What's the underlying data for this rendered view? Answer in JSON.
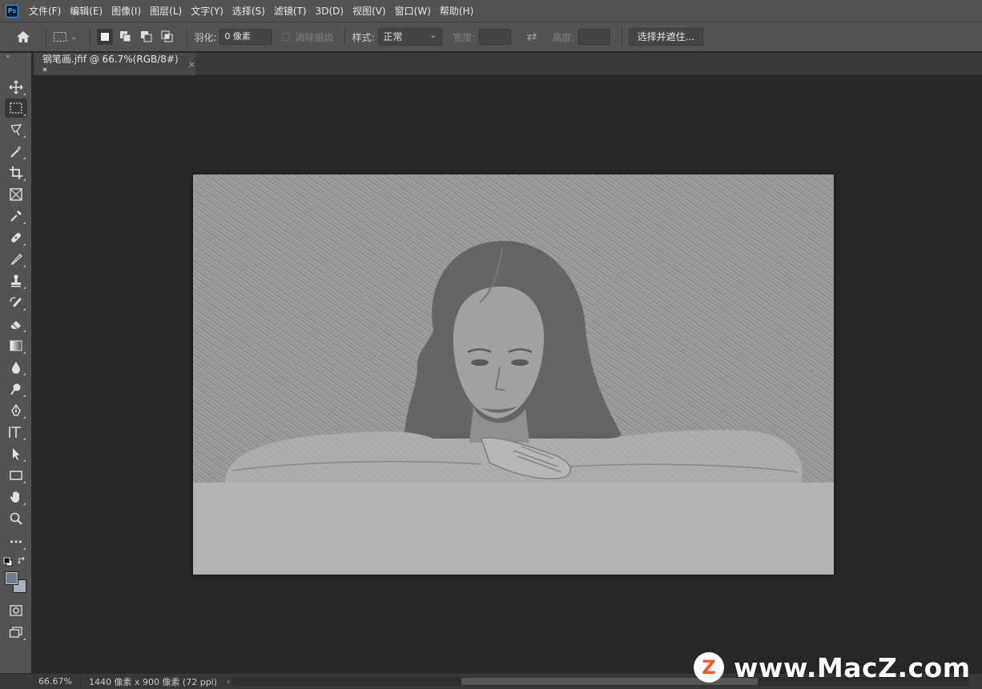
{
  "app": {
    "logo_text": "Ps"
  },
  "menu": [
    "文件(F)",
    "编辑(E)",
    "图像(I)",
    "图层(L)",
    "文字(Y)",
    "选择(S)",
    "滤镜(T)",
    "3D(D)",
    "视图(V)",
    "窗口(W)",
    "帮助(H)"
  ],
  "options": {
    "feather_label": "羽化:",
    "feather_value": "0 像素",
    "antialias_label": "消除锯齿",
    "style_label": "样式:",
    "style_value": "正常",
    "width_label": "宽度:",
    "height_label": "高度:",
    "select_mask_button": "选择并遮住..."
  },
  "tab": {
    "title": "钢笔画.jfif @ 66.7%(RGB/8#) *",
    "close": "×"
  },
  "status": {
    "zoom": "66.67%",
    "doc_info": "1440 像素 x 900 像素 (72 ppi)",
    "arrow": "›"
  },
  "watermark": {
    "logo": "Z",
    "text": "www.MacZ.com"
  },
  "colors": {
    "foreground": "#6f7c8d",
    "background": "#a7b0be",
    "accent": "#31a8ff"
  },
  "tools": [
    "move-icon",
    "marquee-icon",
    "lasso-icon",
    "magic-wand-icon",
    "crop-icon",
    "frame-icon",
    "eyedropper-icon",
    "healing-brush-icon",
    "brush-icon",
    "clone-stamp-icon",
    "history-brush-icon",
    "eraser-icon",
    "gradient-icon",
    "blur-icon",
    "dodge-icon",
    "pen-icon",
    "type-icon",
    "path-selection-icon",
    "rectangle-icon",
    "hand-icon",
    "zoom-icon",
    "more-icon"
  ]
}
